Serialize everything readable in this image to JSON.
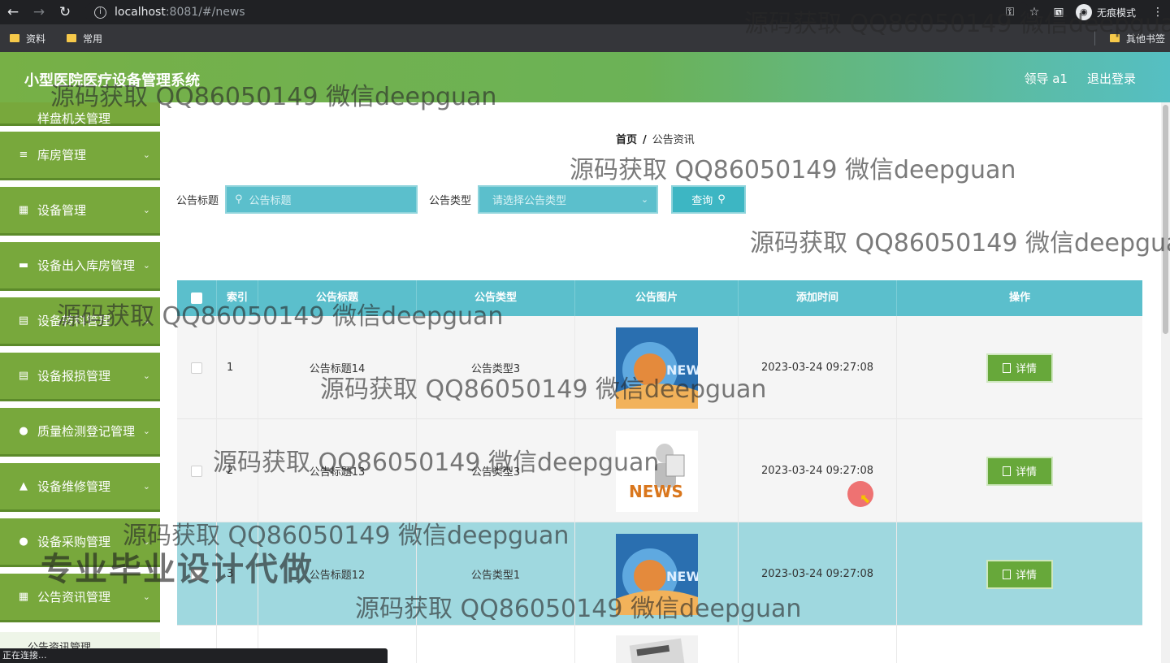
{
  "browser": {
    "url_host": "localhost",
    "url_rest": ":8081/#/news",
    "incognito_label": "无痕模式",
    "bookmarks": [
      "资料",
      "常用"
    ],
    "other_bookmarks": "其他书签",
    "status_text": "正在连接..."
  },
  "header": {
    "title": "小型医院医疗设备管理系统",
    "user": "领导 a1",
    "logout": "退出登录"
  },
  "sidebar": {
    "hidden_label": "样盘机关管理",
    "items": [
      {
        "label": "库房管理",
        "icon": "list-icon"
      },
      {
        "label": "设备管理",
        "icon": "grid-icon"
      },
      {
        "label": "设备出入库房管理",
        "icon": "box-icon"
      },
      {
        "label": "设备转科管理",
        "icon": "clipboard-icon"
      },
      {
        "label": "设备报损管理",
        "icon": "clipboard-icon"
      },
      {
        "label": "质量检测登记管理",
        "icon": "user-icon"
      },
      {
        "label": "设备维修管理",
        "icon": "wrench-icon"
      },
      {
        "label": "设备采购管理",
        "icon": "bulb-icon"
      },
      {
        "label": "公告资讯管理",
        "icon": "grid-icon"
      }
    ],
    "sub_item": "公告资讯管理"
  },
  "breadcrumb": {
    "home": "首页",
    "sep": "/",
    "current": "公告资讯"
  },
  "search": {
    "title_label": "公告标题",
    "title_placeholder": "公告标题",
    "type_label": "公告类型",
    "type_placeholder": "请选择公告类型",
    "button": "查询"
  },
  "table": {
    "headers": [
      "索引",
      "公告标题",
      "公告类型",
      "公告图片",
      "添加时间",
      "操作"
    ],
    "rows": [
      {
        "index": "1",
        "title": "公告标题14",
        "type": "公告类型3",
        "time": "2023-03-24 09:27:08",
        "action": "详情"
      },
      {
        "index": "2",
        "title": "公告标题13",
        "type": "公告类型3",
        "time": "2023-03-24 09:27:08",
        "action": "详情"
      },
      {
        "index": "3",
        "title": "公告标题12",
        "type": "公告类型1",
        "time": "2023-03-24 09:27:08",
        "action": "详情"
      }
    ]
  },
  "watermark": {
    "text": "源码获取 QQ86050149 微信deepguan",
    "ad": "专业毕业设计代做"
  }
}
